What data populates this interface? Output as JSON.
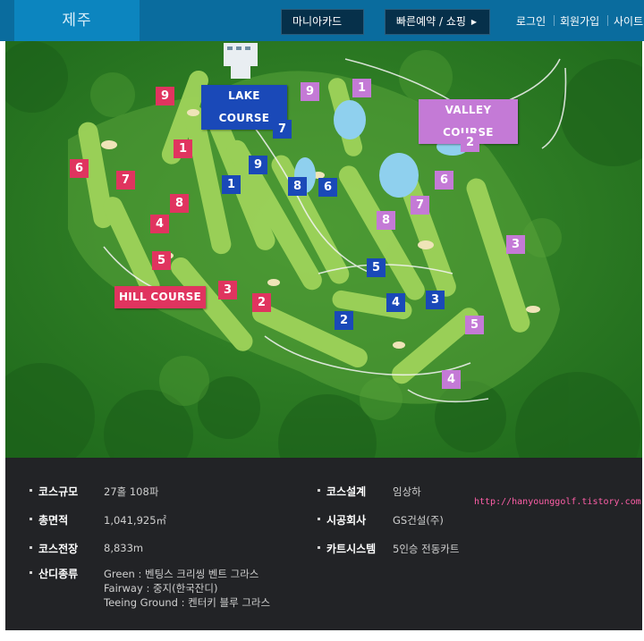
{
  "header": {
    "region": "제주",
    "mania_card": "마니아카드",
    "quick_booking": "빠른예약 / 쇼핑",
    "login": "로그인",
    "signup": "회원가입",
    "site": "사이트"
  },
  "map": {
    "courses": {
      "lake": "LAKE COURSE",
      "valley": "VALLEY COURSE",
      "hill": "HILL COURSE"
    },
    "hill_holes": [
      "1",
      "2",
      "3",
      "4",
      "5",
      "6",
      "7",
      "8",
      "9"
    ],
    "lake_holes": [
      "1",
      "2",
      "3",
      "4",
      "5",
      "6",
      "7",
      "8",
      "9"
    ],
    "valley_holes": [
      "1",
      "2",
      "3",
      "4",
      "5",
      "6",
      "7",
      "8",
      "9"
    ],
    "colors": {
      "hill": "#e0345f",
      "lake": "#1a49b8",
      "valley": "#c47ad6"
    }
  },
  "info": {
    "scale_label": "코스규모",
    "scale_value": "27홀 108파",
    "area_label": "총면적",
    "area_value": "1,041,925㎡",
    "length_label": "코스전장",
    "length_value": "8,833m",
    "grass_label": "산디종류",
    "grass_green": "Green : 벤팅스 크리씽 벤트 그라스",
    "grass_fairway": "Fairway : 중지(한국잔디)",
    "grass_teeing": "Teeing Ground : 켄터키 블루 그라스",
    "designer_label": "코스설계",
    "designer_value": "임상하",
    "builder_label": "시공회사",
    "builder_value": "GS건설(주)",
    "cart_label": "카트시스템",
    "cart_value": "5인승 전동카트",
    "watermark": "http://hanyounggolf.tistory.com"
  }
}
